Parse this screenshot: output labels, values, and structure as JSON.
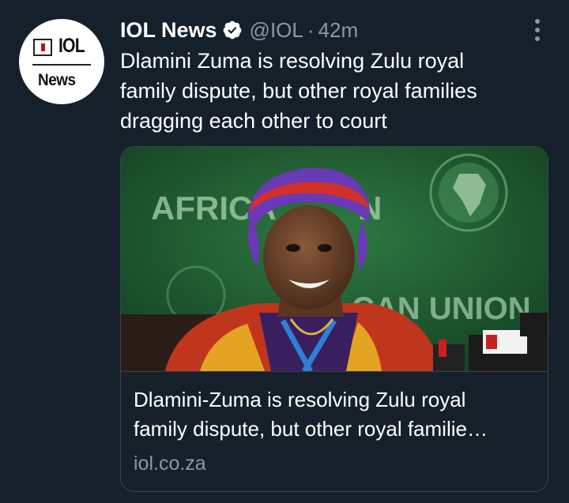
{
  "tweet": {
    "author": {
      "name": "IOL News",
      "handle": "@IOL",
      "time": "42m",
      "separator": "·",
      "avatar_text_top": "IOL",
      "avatar_text_bottom": "News",
      "verified_icon": "verified-badge-icon"
    },
    "text": "Dlamini Zuma is resolving Zulu royal\nfamily dispute, but other royal families\ndragging each other to court",
    "more_icon": "more-vertical-icon"
  },
  "card": {
    "image_text_left": "AFRICA",
    "image_text_right": "N",
    "image_text_bottom": "CAN UNION",
    "title": "Dlamini-Zuma is resolving Zulu royal\nfamily dispute, but other royal familie…",
    "domain": "iol.co.za"
  },
  "colors": {
    "background": "#15202b",
    "text_primary": "#ffffff",
    "text_secondary": "#8b98a5",
    "border": "#38444d",
    "verified_badge": "#ffffff"
  }
}
